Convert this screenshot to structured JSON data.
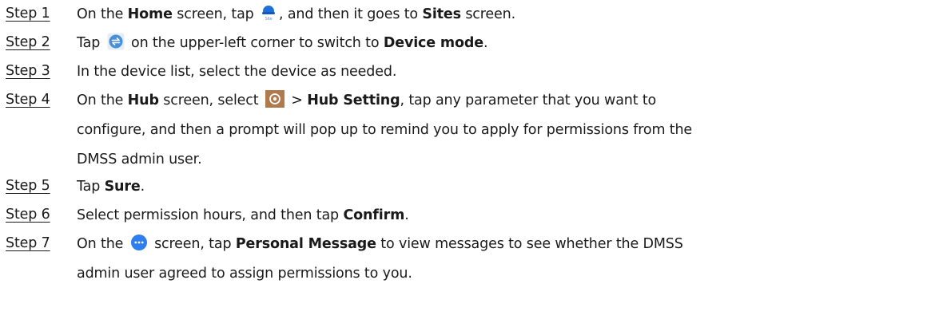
{
  "steps": [
    {
      "label": "Step 1",
      "parts": {
        "t1": "On the ",
        "b1": "Home",
        "t2": " screen, tap ",
        "icon": "site-icon",
        "t3": ", and then it goes to ",
        "b2": "Sites",
        "t4": " screen."
      }
    },
    {
      "label": "Step 2",
      "parts": {
        "t1": "Tap ",
        "icon": "switch-mode-icon",
        "t2": " on the upper-left corner to switch to ",
        "b1": "Device mode",
        "t3": "."
      }
    },
    {
      "label": "Step 3",
      "parts": {
        "t1": "In the device list, select the device as needed."
      }
    },
    {
      "label": "Step 4",
      "parts": {
        "t1": "On the ",
        "b1": "Hub",
        "t2": " screen, select ",
        "icon": "settings-icon",
        "t3": " > ",
        "b2": "Hub Setting",
        "t4": ", tap any parameter that you want to",
        "line2": "configure, and then a prompt will pop up to remind you to apply for permissions from the",
        "line3": "DMSS admin user."
      }
    },
    {
      "label": "Step 5",
      "parts": {
        "t1": "Tap ",
        "b1": "Sure",
        "t2": "."
      }
    },
    {
      "label": "Step 6",
      "parts": {
        "t1": "Select permission hours, and then tap ",
        "b1": "Confirm",
        "t2": "."
      }
    },
    {
      "label": "Step 7",
      "parts": {
        "t1": "On the ",
        "icon": "message-icon",
        "t2": " screen, tap ",
        "b1": "Personal Message",
        "t3": " to view messages to see whether the DMSS",
        "line2": "admin user agreed to assign permissions to you."
      }
    }
  ],
  "colors": {
    "text": "#1a1a1a",
    "site_icon_blue": "#1e6fd9",
    "switch_icon_blue": "#4a90d9",
    "settings_icon_brown": "#b07a4f",
    "message_icon_blue": "#2f7ef0"
  }
}
